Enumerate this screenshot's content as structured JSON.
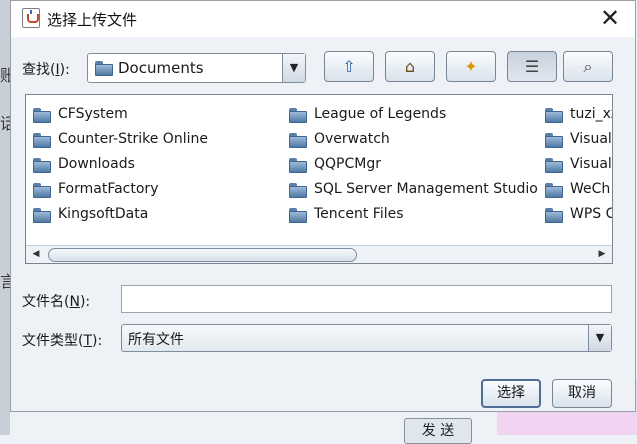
{
  "background": {
    "send_label": "发 送",
    "side_chars": [
      "账",
      "话",
      "言"
    ]
  },
  "dialog": {
    "title": "选择上传文件",
    "close_glyph": "✕"
  },
  "lookin": {
    "label_prefix": "查找(",
    "label_mnemonic": "I",
    "label_suffix": "):",
    "value": "Documents"
  },
  "toolbar": {
    "buttons": [
      {
        "name": "up-one-level-icon",
        "glyph": "⇧"
      },
      {
        "name": "home-icon",
        "glyph": "⌂"
      },
      {
        "name": "new-folder-icon",
        "glyph": "✦"
      },
      {
        "name": "list-view-icon",
        "glyph": "☰"
      },
      {
        "name": "details-view-icon",
        "glyph": "⌕"
      }
    ]
  },
  "files": {
    "col1": [
      "CFSystem",
      "Counter-Strike Online",
      "Downloads",
      "FormatFactory",
      "KingsoftData"
    ],
    "col2": [
      "League of Legends",
      "Overwatch",
      "QQPCMgr",
      "SQL Server Management Studio",
      "Tencent Files"
    ],
    "col3": [
      "tuzi_xz",
      "Visual",
      "Visual",
      "WeCh",
      "WPS C"
    ]
  },
  "filename": {
    "label_prefix": "文件名(",
    "label_mnemonic": "N",
    "label_suffix": "):",
    "value": ""
  },
  "filetype": {
    "label_prefix": "文件类型(",
    "label_mnemonic": "T",
    "label_suffix": "):",
    "value": "所有文件"
  },
  "buttons": {
    "select": "选择",
    "cancel": "取消"
  },
  "colors": {
    "folder": "#4f78a4",
    "primary_border": "#4e6e93"
  }
}
